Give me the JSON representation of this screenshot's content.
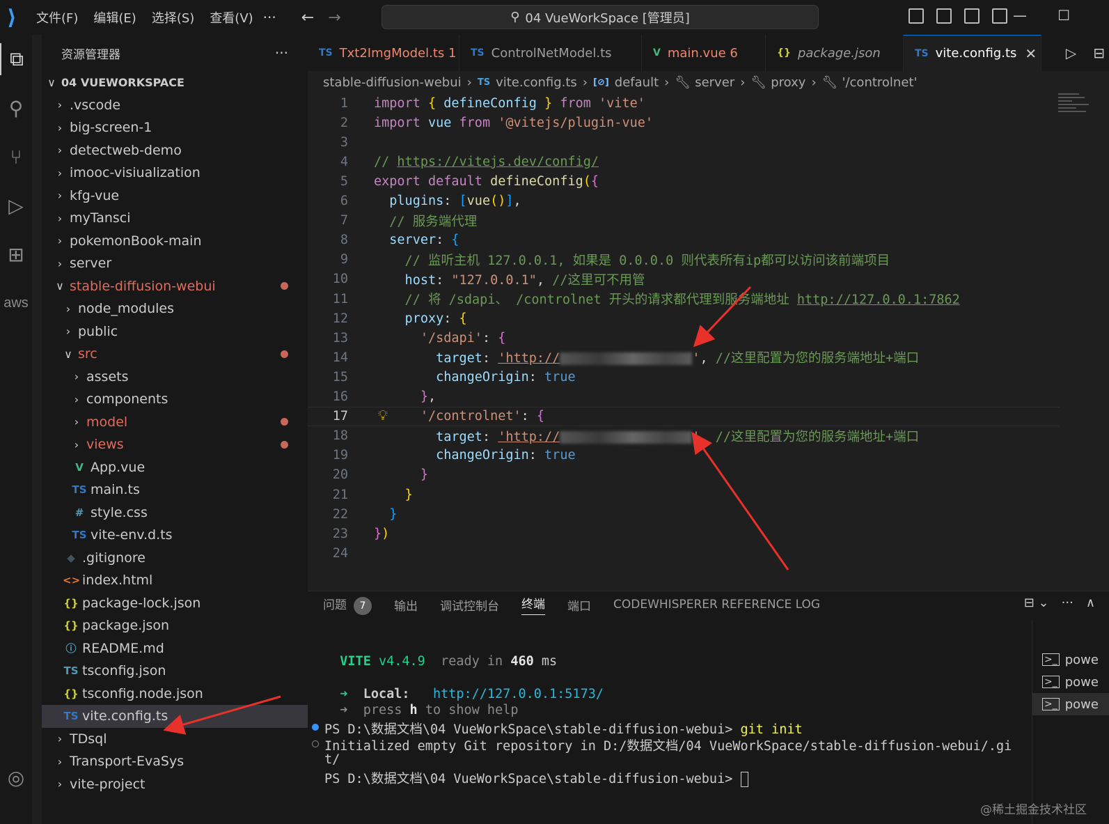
{
  "titlebar": {
    "menus": [
      "文件(F)",
      "编辑(E)",
      "选择(S)",
      "查看(V)"
    ],
    "more": "···",
    "search_text": "04 VueWorkSpace [管理员]"
  },
  "activity": {
    "aws_label": "aws"
  },
  "explorer": {
    "title": "资源管理器",
    "more": "···",
    "items": [
      {
        "label": "04 VUEWORKSPACE",
        "chev": "∨",
        "indent": 0,
        "root": true
      },
      {
        "label": ".vscode",
        "chev": "›",
        "indent": 1
      },
      {
        "label": "big-screen-1",
        "chev": "›",
        "indent": 1
      },
      {
        "label": "detectweb-demo",
        "chev": "›",
        "indent": 1
      },
      {
        "label": "imooc-visiualization",
        "chev": "›",
        "indent": 1
      },
      {
        "label": "kfg-vue",
        "chev": "›",
        "indent": 1
      },
      {
        "label": "myTansci",
        "chev": "›",
        "indent": 1
      },
      {
        "label": "pokemonBook-main",
        "chev": "›",
        "indent": 1
      },
      {
        "label": "server",
        "chev": "›",
        "indent": 1
      },
      {
        "label": "stable-diffusion-webui",
        "chev": "∨",
        "indent": 1,
        "modified": true
      },
      {
        "label": "node_modules",
        "chev": "›",
        "indent": 2
      },
      {
        "label": "public",
        "chev": "›",
        "indent": 2
      },
      {
        "label": "src",
        "chev": "∨",
        "indent": 2,
        "modified": true
      },
      {
        "label": "assets",
        "chev": "›",
        "indent": 3
      },
      {
        "label": "components",
        "chev": "›",
        "indent": 3
      },
      {
        "label": "model",
        "chev": "›",
        "indent": 3,
        "modified": true
      },
      {
        "label": "views",
        "chev": "›",
        "indent": 3,
        "modified": true
      },
      {
        "label": "App.vue",
        "icon": "V",
        "iconColor": "#41b883",
        "indent": 3
      },
      {
        "label": "main.ts",
        "icon": "TS",
        "iconColor": "#3178c6",
        "indent": 3
      },
      {
        "label": "style.css",
        "icon": "#",
        "iconColor": "#519aba",
        "indent": 3
      },
      {
        "label": "vite-env.d.ts",
        "icon": "TS",
        "iconColor": "#3178c6",
        "indent": 3
      },
      {
        "label": ".gitignore",
        "icon": "◆",
        "iconColor": "#41535b",
        "indent": 2
      },
      {
        "label": "index.html",
        "icon": "<>",
        "iconColor": "#e37933",
        "indent": 2
      },
      {
        "label": "package-lock.json",
        "icon": "{}",
        "iconColor": "#cbcb41",
        "indent": 2
      },
      {
        "label": "package.json",
        "icon": "{}",
        "iconColor": "#cbcb41",
        "indent": 2
      },
      {
        "label": "README.md",
        "icon": "ⓘ",
        "iconColor": "#519aba",
        "indent": 2
      },
      {
        "label": "tsconfig.json",
        "icon": "TS",
        "iconColor": "#519aba",
        "indent": 2
      },
      {
        "label": "tsconfig.node.json",
        "icon": "{}",
        "iconColor": "#cbcb41",
        "indent": 2
      },
      {
        "label": "vite.config.ts",
        "icon": "TS",
        "iconColor": "#3178c6",
        "indent": 2,
        "selected": true
      },
      {
        "label": "TDsql",
        "chev": "›",
        "indent": 1
      },
      {
        "label": "Transport-EvaSys",
        "chev": "›",
        "indent": 1
      },
      {
        "label": "vite-project",
        "chev": "›",
        "indent": 1
      }
    ]
  },
  "tabs": [
    {
      "icon": "TS",
      "iconColor": "#3178c6",
      "label": "Txt2ImgModel.ts",
      "badge": "1",
      "error": true
    },
    {
      "icon": "TS",
      "iconColor": "#3178c6",
      "label": "ControlNetModel.ts"
    },
    {
      "icon": "V",
      "iconColor": "#41b883",
      "label": "main.vue",
      "badge": "6",
      "error": true
    },
    {
      "icon": "{}",
      "iconColor": "#cbcb41",
      "label": "package.json",
      "italic": true
    },
    {
      "icon": "TS",
      "iconColor": "#3178c6",
      "label": "vite.config.ts",
      "active": true,
      "close": "✕"
    }
  ],
  "breadcrumb": {
    "folder": "stable-diffusion-webui",
    "file_icon": "TS",
    "file": "vite.config.ts",
    "crumbs": [
      "default",
      "server",
      "proxy",
      "'/controlnet'"
    ]
  },
  "editor": {
    "current_line": 17,
    "lines": [
      [
        [
          "import",
          "k"
        ],
        [
          " ",
          "p"
        ],
        [
          "{",
          "b1"
        ],
        [
          " ",
          "p"
        ],
        [
          "defineConfig",
          "v"
        ],
        [
          " ",
          "p"
        ],
        [
          "}",
          "b1"
        ],
        [
          " ",
          "p"
        ],
        [
          "from",
          "k"
        ],
        [
          " ",
          "p"
        ],
        [
          "'vite'",
          "s"
        ]
      ],
      [
        [
          "import",
          "k"
        ],
        [
          " ",
          "p"
        ],
        [
          "vue",
          "v"
        ],
        [
          " ",
          "p"
        ],
        [
          "from",
          "k"
        ],
        [
          " ",
          "p"
        ],
        [
          "'@vitejs/plugin-vue'",
          "s"
        ]
      ],
      [],
      [
        [
          "// ",
          "c"
        ],
        [
          "https://vitejs.dev/config/",
          "c u"
        ]
      ],
      [
        [
          "export",
          "k"
        ],
        [
          " ",
          "p"
        ],
        [
          "default",
          "k"
        ],
        [
          " ",
          "p"
        ],
        [
          "defineConfig",
          "f"
        ],
        [
          "(",
          "b1"
        ],
        [
          "{",
          "b2"
        ]
      ],
      [
        [
          "  plugins",
          "v"
        ],
        [
          ": ",
          "p"
        ],
        [
          "[",
          "b3"
        ],
        [
          "vue",
          "f"
        ],
        [
          "()",
          "b1"
        ],
        [
          "]",
          "b3"
        ],
        [
          ",",
          "p"
        ]
      ],
      [
        [
          "  // 服务端代理",
          "c"
        ]
      ],
      [
        [
          "  server",
          "v"
        ],
        [
          ": ",
          "p"
        ],
        [
          "{",
          "b3"
        ]
      ],
      [
        [
          "    // 监听主机 127.0.0.1, 如果是 0.0.0.0 则代表所有ip都可以访问该前端项目",
          "c"
        ]
      ],
      [
        [
          "    host",
          "v"
        ],
        [
          ": ",
          "p"
        ],
        [
          "\"127.0.0.1\"",
          "s"
        ],
        [
          ", ",
          "p"
        ],
        [
          "//这里可不用管",
          "c"
        ]
      ],
      [
        [
          "    // 将 /sdapi、 /controlnet 开头的请求都代理到服务端地址 ",
          "c"
        ],
        [
          "http://127.0.0.1:7862",
          "c u"
        ]
      ],
      [
        [
          "    proxy",
          "v"
        ],
        [
          ": ",
          "p"
        ],
        [
          "{",
          "b1"
        ]
      ],
      [
        [
          "      ",
          "p"
        ],
        [
          "'/sdapi'",
          "s"
        ],
        [
          ": ",
          "p"
        ],
        [
          "{",
          "b2"
        ]
      ],
      [
        [
          "        target",
          "v"
        ],
        [
          ": ",
          "p"
        ],
        [
          "'http://",
          "s u"
        ],
        [
          "REDACT",
          "redact"
        ],
        [
          "'",
          "s"
        ],
        [
          ", ",
          "p"
        ],
        [
          "//这里配置为您的服务端地址+端口",
          "c"
        ]
      ],
      [
        [
          "        changeOrigin",
          "v"
        ],
        [
          ": ",
          "p"
        ],
        [
          "true",
          "kb"
        ]
      ],
      [
        [
          "      ",
          "p"
        ],
        [
          "}",
          "b2"
        ],
        [
          ",",
          "p"
        ]
      ],
      [
        [
          "      ",
          "p"
        ],
        [
          "'/controlnet'",
          "s"
        ],
        [
          ": ",
          "p"
        ],
        [
          "{",
          "b2"
        ]
      ],
      [
        [
          "        target",
          "v"
        ],
        [
          ": ",
          "p"
        ],
        [
          "'http://",
          "s u"
        ],
        [
          "REDACT",
          "redact"
        ],
        [
          "'",
          "s"
        ],
        [
          ", ",
          "p"
        ],
        [
          "//这里配置为您的服务端地址+端口",
          "c"
        ]
      ],
      [
        [
          "        changeOrigin",
          "v"
        ],
        [
          ": ",
          "p"
        ],
        [
          "true",
          "kb"
        ]
      ],
      [
        [
          "      ",
          "p"
        ],
        [
          "}",
          "b2"
        ]
      ],
      [
        [
          "    ",
          "p"
        ],
        [
          "}",
          "b1"
        ]
      ],
      [
        [
          "  ",
          "p"
        ],
        [
          "}",
          "b3"
        ]
      ],
      [
        [
          "}",
          "b2"
        ],
        [
          ")",
          "b1"
        ]
      ],
      []
    ]
  },
  "panel": {
    "tabs": [
      "问题",
      "输出",
      "调试控制台",
      "终端",
      "端口",
      "CODEWHISPERER REFERENCE LOG"
    ],
    "problems_badge": "7",
    "active_tab": "终端",
    "actions": [
      "⊟ ⌄",
      "···",
      "∧"
    ],
    "terminal": {
      "vite_name": "VITE",
      "vite_version": "v4.4.9",
      "ready": "ready in",
      "ready_ms": "460",
      "ms": "ms",
      "local_arrow": "➜",
      "local_label": "Local:",
      "local_url": "http://127.0.0.1:5173/",
      "help_prefix": "press",
      "help_key": "h",
      "help_suffix": "to show help",
      "prompt1": "PS D:\\数据文档\\04 VueWorkSpace\\stable-diffusion-webui>",
      "cmd1": "git init",
      "out1": "Initialized empty Git repository in D:/数据文档/04 VueWorkSpace/stable-diffusion-webui/.gi",
      "out2": "t/",
      "prompt2": "PS D:\\数据文档\\04 VueWorkSpace\\stable-diffusion-webui>"
    },
    "terminal_list": [
      "powe",
      "powe",
      "powe"
    ]
  },
  "watermark": "@稀土掘金技术社区"
}
